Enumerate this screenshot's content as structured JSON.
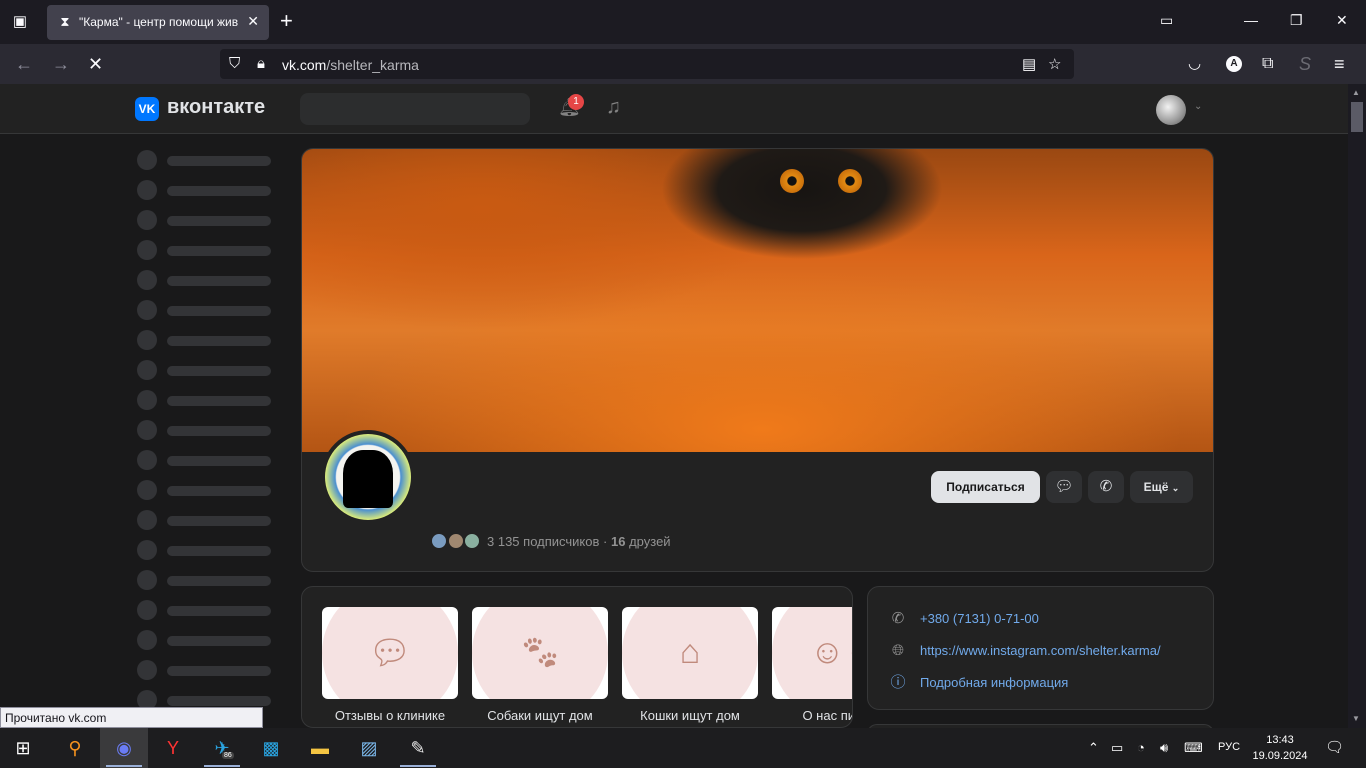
{
  "browser": {
    "tab_title": "\"Карма\" - центр помощи жив",
    "url_domain": "vk.com",
    "url_path": "/shelter_karma",
    "status_text": "Прочитано vk.com",
    "icons": [
      "tab-list-icon",
      "hourglass-icon",
      "close-icon",
      "new-tab-icon",
      "back-icon",
      "forward-icon",
      "stop-icon",
      "shield-icon",
      "lock-icon",
      "reader-icon",
      "star-icon",
      "pocket-icon",
      "account-icon",
      "extensions-icon",
      "menu-icon"
    ]
  },
  "vk": {
    "brand": "вконтакте",
    "logo_text": "VK",
    "notification_count": "1",
    "accent": "#0077ff"
  },
  "group": {
    "subscribe_label": "Подписаться",
    "more_label": "Ещё",
    "followers_count": "3 135",
    "followers_word": "подписчиков",
    "separator": "·",
    "friends_count": "16",
    "friends_word": "друзей"
  },
  "menu": {
    "items": [
      {
        "label": "Отзывы о клинике",
        "icon": "speech-question-icon"
      },
      {
        "label": "Собаки ищут дом",
        "icon": "paw-icon"
      },
      {
        "label": "Кошки ищут дом",
        "icon": "house-icon"
      },
      {
        "label": "О нас пи",
        "icon": "faces-icon"
      }
    ]
  },
  "info": {
    "phone": "+380 (7131) 0-71-00",
    "link": "https://www.instagram.com/shelter.karma/",
    "details": "Подробная информация"
  },
  "taskbar": {
    "telegram_badge": "86",
    "language": "РУС",
    "time": "13:43",
    "date": "19.09.2024"
  }
}
